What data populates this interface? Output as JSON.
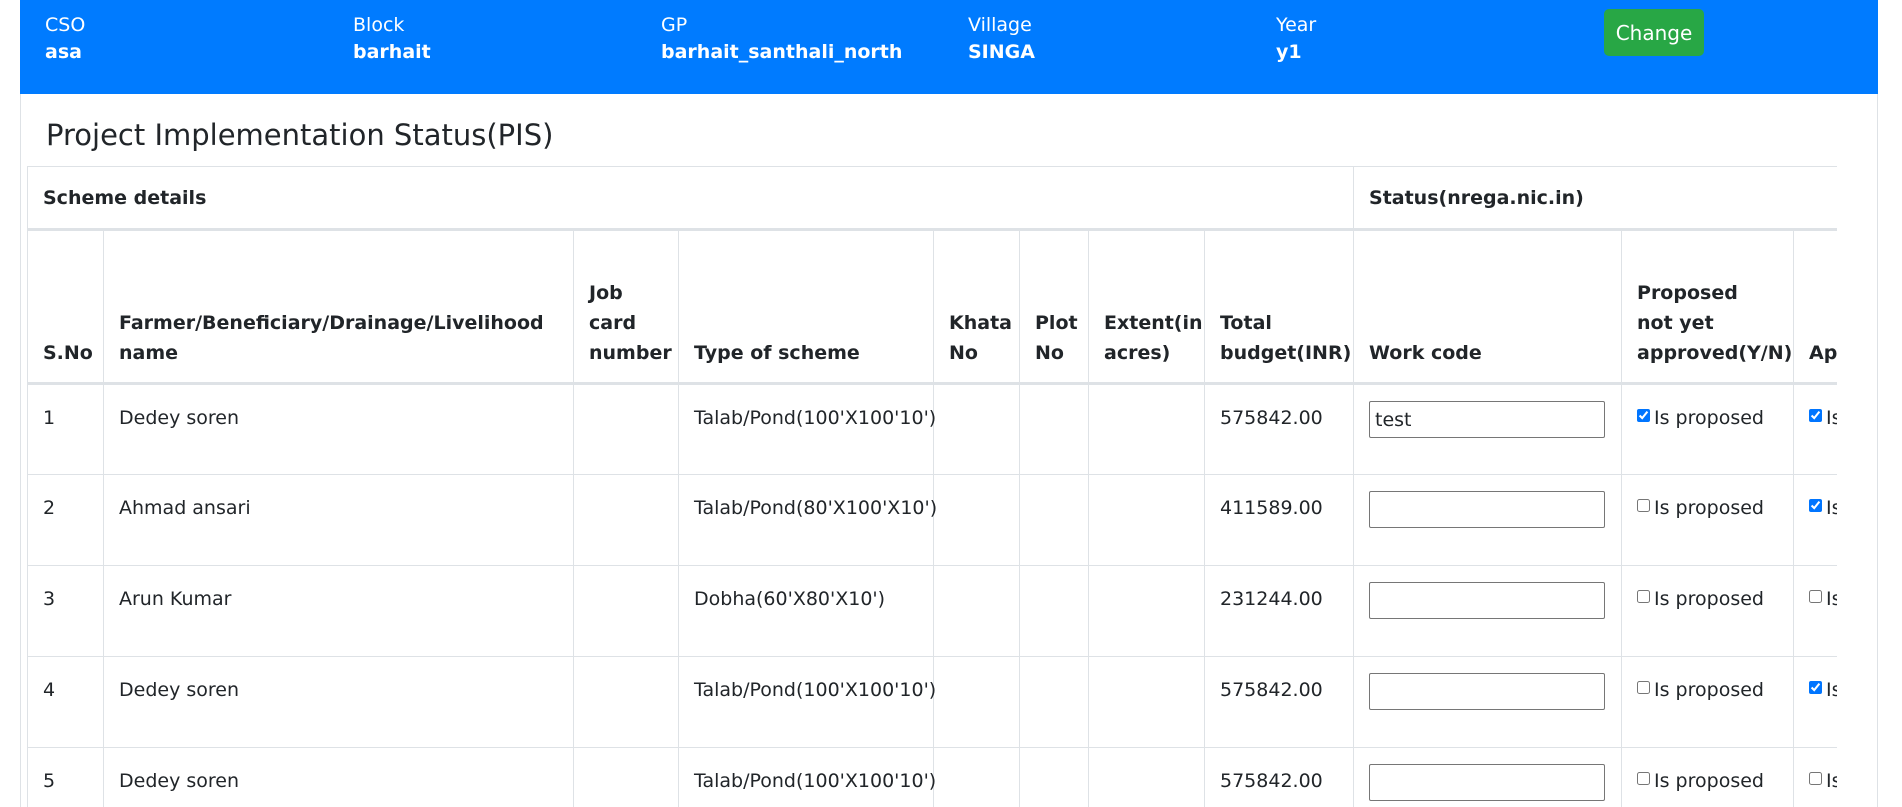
{
  "header": {
    "fields": [
      {
        "label": "CSO",
        "value": "asa"
      },
      {
        "label": "Block",
        "value": "barhait"
      },
      {
        "label": "GP",
        "value": "barhait_santhali_north"
      },
      {
        "label": "Village",
        "value": "SINGA"
      },
      {
        "label": "Year",
        "value": "y1"
      }
    ],
    "change_label": "Change"
  },
  "page": {
    "title": "Project Implementation Status(PIS)"
  },
  "table": {
    "groups": {
      "scheme": "Scheme details",
      "status": "Status(nrega.nic.in)"
    },
    "columns": {
      "sno": "S.No",
      "name": "Farmer/Beneficiary/Drainage/Livelihood name",
      "job": "Job card number",
      "type": "Type of scheme",
      "khata": "Khata No",
      "plot": "Plot No",
      "extent": "Extent(in acres)",
      "budget": "Total budget(INR)",
      "workcode": "Work code",
      "proposed": "Proposed not yet approved(Y/N)",
      "approved": "Approved not started"
    },
    "checkbox_labels": {
      "proposed": "Is proposed",
      "approved": "Is Approved"
    },
    "rows": [
      {
        "sno": "1",
        "name": "Dedey soren",
        "job": "",
        "type": "Talab/Pond(100'X100'10')",
        "khata": "",
        "plot": "",
        "extent": "",
        "budget": "575842.00",
        "workcode": "test",
        "proposed": true,
        "approved": true
      },
      {
        "sno": "2",
        "name": "Ahmad ansari",
        "job": "",
        "type": "Talab/Pond(80'X100'X10')",
        "khata": "",
        "plot": "",
        "extent": "",
        "budget": "411589.00",
        "workcode": "",
        "proposed": false,
        "approved": true
      },
      {
        "sno": "3",
        "name": "Arun Kumar",
        "job": "",
        "type": "Dobha(60'X80'X10')",
        "khata": "",
        "plot": "",
        "extent": "",
        "budget": "231244.00",
        "workcode": "",
        "proposed": false,
        "approved": false
      },
      {
        "sno": "4",
        "name": "Dedey soren",
        "job": "",
        "type": "Talab/Pond(100'X100'10')",
        "khata": "",
        "plot": "",
        "extent": "",
        "budget": "575842.00",
        "workcode": "",
        "proposed": false,
        "approved": true
      },
      {
        "sno": "5",
        "name": "Dedey soren",
        "job": "",
        "type": "Talab/Pond(100'X100'10')",
        "khata": "",
        "plot": "",
        "extent": "",
        "budget": "575842.00",
        "workcode": "",
        "proposed": false,
        "approved": false
      }
    ]
  }
}
